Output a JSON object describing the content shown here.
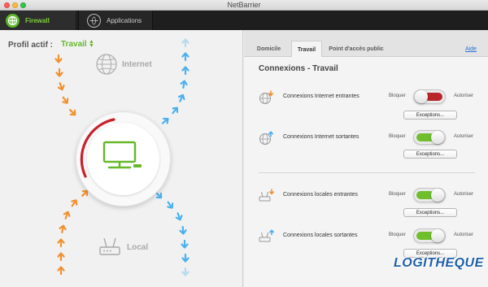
{
  "window": {
    "title": "NetBarrier"
  },
  "toolbar": {
    "tabs": [
      {
        "label": "Firewall",
        "icon": "shield-globe-icon",
        "active": true
      },
      {
        "label": "Applications",
        "icon": "applications-globe-icon",
        "active": false
      }
    ]
  },
  "profile": {
    "label": "Profil actif :",
    "value": "Travail"
  },
  "diagram": {
    "internet_label": "Internet",
    "local_label": "Local"
  },
  "colors": {
    "accent": "#66b82b",
    "incoming_arrow": "#f0912e",
    "outgoing_arrow": "#4ab0ef",
    "block_red": "#b8262b"
  },
  "tabs": [
    {
      "label": "Domicile",
      "active": false
    },
    {
      "label": "Travail",
      "active": true
    },
    {
      "label": "Point d'accès public",
      "active": false
    }
  ],
  "help": "Aide",
  "panel": {
    "title": "Connexions - Travail",
    "rows": [
      {
        "label": "Connexions Internet entrantes",
        "block": "Bloquer",
        "allow": "Autoriser",
        "state": "Bloquer",
        "button": "Exceptions...",
        "icon": "globe-incoming-icon"
      },
      {
        "label": "Connexions Internet sortantes",
        "block": "Bloquer",
        "allow": "Autoriser",
        "state": "Autoriser",
        "button": "Exceptions...",
        "icon": "globe-outgoing-icon"
      },
      {
        "label": "Connexions locales entrantes",
        "block": "Bloquer",
        "allow": "Autoriser",
        "state": "Autoriser",
        "button": "Exceptions...",
        "icon": "router-incoming-icon"
      },
      {
        "label": "Connexions locales sortantes",
        "block": "Bloquer",
        "allow": "Autoriser",
        "state": "Autoriser",
        "button": "Exceptions...",
        "icon": "router-outgoing-icon"
      }
    ]
  },
  "watermark": "LOGITHEQUE"
}
